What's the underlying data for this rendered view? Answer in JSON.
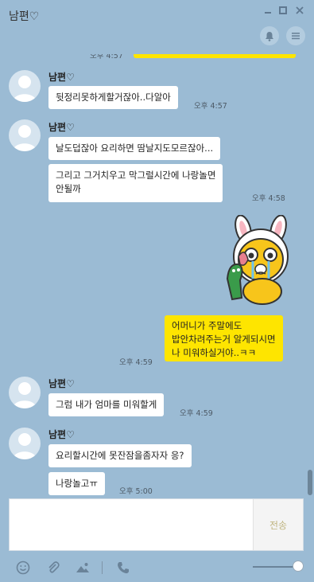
{
  "window": {
    "title": "남편♡"
  },
  "chat": {
    "top_time": "오후 4:57",
    "messages": [
      {
        "sender": "남편♡",
        "text": "뒷정리못하게할거잖아..다알아",
        "time": "오후 4:57"
      },
      {
        "sender": "남편♡",
        "text": "날도덥잖아 요리하면 땀날지도모르잖아...",
        "time": ""
      },
      {
        "sender": "",
        "text_lines": [
          "그리고 그거치우고 막그럴시간에 나랑놀면",
          "안될까"
        ],
        "time": "오후 4:58"
      },
      {
        "sender": "me",
        "text_lines": [
          "어머니가 주말에도",
          "밥안차려주는거 알게되시면",
          "나 미워하실거야..ㅋㅋ"
        ],
        "time": "오후 4:59"
      },
      {
        "sender": "남편♡",
        "text": "그럼 내가 엄마를 미워할게",
        "time": "오후 4:59"
      },
      {
        "sender": "남편♡",
        "text": "요리할시간에 못잔잠을좀자자 응?",
        "time": ""
      },
      {
        "sender": "",
        "text": "나랑놀고ㅠ",
        "time": "오후 5:00"
      }
    ]
  },
  "input": {
    "placeholder": "",
    "send_label": "전송"
  },
  "icons": {
    "notify": "bell-icon",
    "menu": "menu-icon",
    "emoji": "emoji-icon",
    "attach": "paperclip-icon",
    "photo": "image-icon",
    "call": "phone-icon"
  },
  "colors": {
    "background": "#9bbbd4",
    "my_bubble": "#fee500",
    "other_bubble": "#ffffff"
  }
}
